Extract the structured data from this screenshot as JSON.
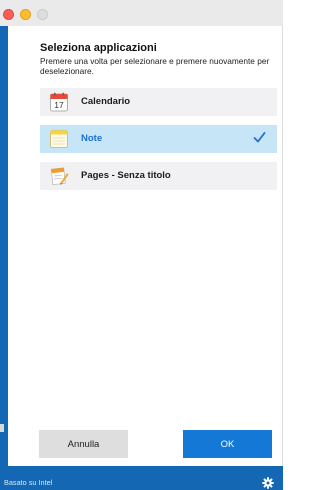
{
  "window": {
    "controls": [
      "close",
      "minimize",
      "maximize"
    ]
  },
  "dialog": {
    "heading": "Seleziona applicazioni",
    "instructions": "Premere una volta per selezionare e premere nuovamente per deselezionare."
  },
  "apps": [
    {
      "label": "Calendario",
      "icon": "calendar-icon",
      "calendar_day": "17",
      "selected": false
    },
    {
      "label": "Note",
      "icon": "notes-icon",
      "selected": true
    },
    {
      "label": "Pages - Senza titolo",
      "icon": "pages-icon",
      "selected": false
    }
  ],
  "buttons": {
    "cancel": "Annulla",
    "ok": "OK"
  },
  "footer": {
    "text": "Basato su Intel",
    "settings_icon": "gear-icon"
  },
  "colors": {
    "frame": "#1468b3",
    "selected_row": "#c6e6f8",
    "row": "#f1f1f3",
    "accent": "#1479d6",
    "check": "#1c6fd6"
  }
}
